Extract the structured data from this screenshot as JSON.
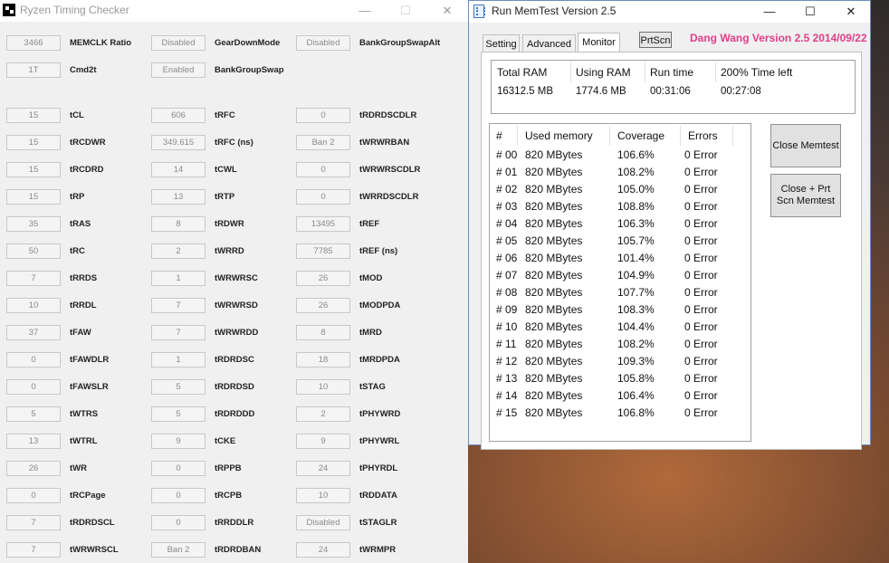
{
  "rtc": {
    "title": "Ryzen Timing Checker",
    "minimize": "—",
    "maximize": "☐",
    "close": "✕",
    "top_rows": [
      [
        {
          "v": "3466",
          "l": "MEMCLK Ratio"
        },
        {
          "v": "Disabled",
          "l": "GearDownMode"
        },
        {
          "v": "Disabled",
          "l": "BankGroupSwapAlt"
        }
      ],
      [
        {
          "v": "1T",
          "l": "Cmd2t"
        },
        {
          "v": "Enabled",
          "l": "BankGroupSwap"
        }
      ]
    ],
    "rows": [
      [
        {
          "v": "15",
          "l": "tCL"
        },
        {
          "v": "606",
          "l": "tRFC"
        },
        {
          "v": "0",
          "l": "tRDRDSCDLR"
        }
      ],
      [
        {
          "v": "15",
          "l": "tRCDWR"
        },
        {
          "v": "349.615",
          "l": "tRFC (ns)"
        },
        {
          "v": "Ban 2",
          "l": "tWRWRBAN"
        }
      ],
      [
        {
          "v": "15",
          "l": "tRCDRD"
        },
        {
          "v": "14",
          "l": "tCWL"
        },
        {
          "v": "0",
          "l": "tWRWRSCDLR"
        }
      ],
      [
        {
          "v": "15",
          "l": "tRP"
        },
        {
          "v": "13",
          "l": "tRTP"
        },
        {
          "v": "0",
          "l": "tWRRDSCDLR"
        }
      ],
      [
        {
          "v": "35",
          "l": "tRAS"
        },
        {
          "v": "8",
          "l": "tRDWR"
        },
        {
          "v": "13495",
          "l": "tREF"
        }
      ],
      [
        {
          "v": "50",
          "l": "tRC"
        },
        {
          "v": "2",
          "l": "tWRRD"
        },
        {
          "v": "7785",
          "l": "tREF (ns)"
        }
      ],
      [
        {
          "v": "7",
          "l": "tRRDS"
        },
        {
          "v": "1",
          "l": "tWRWRSC"
        },
        {
          "v": "26",
          "l": "tMOD"
        }
      ],
      [
        {
          "v": "10",
          "l": "tRRDL"
        },
        {
          "v": "7",
          "l": "tWRWRSD"
        },
        {
          "v": "26",
          "l": "tMODPDA"
        }
      ],
      [
        {
          "v": "37",
          "l": "tFAW"
        },
        {
          "v": "7",
          "l": "tWRWRDD"
        },
        {
          "v": "8",
          "l": "tMRD"
        }
      ],
      [
        {
          "v": "0",
          "l": "tFAWDLR"
        },
        {
          "v": "1",
          "l": "tRDRDSC"
        },
        {
          "v": "18",
          "l": "tMRDPDA"
        }
      ],
      [
        {
          "v": "0",
          "l": "tFAWSLR"
        },
        {
          "v": "5",
          "l": "tRDRDSD"
        },
        {
          "v": "10",
          "l": "tSTAG"
        }
      ],
      [
        {
          "v": "5",
          "l": "tWTRS"
        },
        {
          "v": "5",
          "l": "tRDRDDD"
        },
        {
          "v": "2",
          "l": "tPHYWRD"
        }
      ],
      [
        {
          "v": "13",
          "l": "tWTRL"
        },
        {
          "v": "9",
          "l": "tCKE"
        },
        {
          "v": "9",
          "l": "tPHYWRL"
        }
      ],
      [
        {
          "v": "26",
          "l": "tWR"
        },
        {
          "v": "0",
          "l": "tRPPB"
        },
        {
          "v": "24",
          "l": "tPHYRDL"
        }
      ],
      [
        {
          "v": "0",
          "l": "tRCPage"
        },
        {
          "v": "0",
          "l": "tRCPB"
        },
        {
          "v": "10",
          "l": "tRDDATA"
        }
      ],
      [
        {
          "v": "7",
          "l": "tRDRDSCL"
        },
        {
          "v": "0",
          "l": "tRRDDLR"
        },
        {
          "v": "Disabled",
          "l": "tSTAGLR"
        }
      ],
      [
        {
          "v": "7",
          "l": "tWRWRSCL"
        },
        {
          "v": "Ban 2",
          "l": "tRDRDBAN"
        },
        {
          "v": "24",
          "l": "tWRMPR"
        }
      ]
    ]
  },
  "memtest": {
    "title": "Run MemTest Version 2.5",
    "minimize": "—",
    "maximize": "☐",
    "close": "✕",
    "tabs": [
      "Setting",
      "Advanced",
      "Monitor"
    ],
    "prtscn": "PrtScn",
    "credit": "Dang Wang Version 2.5 2014/09/22",
    "stats": {
      "headers": [
        "Total RAM",
        "Using RAM",
        "Run time",
        "200% Time left"
      ],
      "values": [
        "16312.5 MB",
        "1774.6 MB",
        "00:31:06",
        "00:27:08"
      ]
    },
    "list_headers": [
      "#",
      "Used memory",
      "Coverage",
      "Errors"
    ],
    "rows": [
      [
        "# 00",
        "820 MBytes",
        "106.6%",
        "0 Error"
      ],
      [
        "# 01",
        "820 MBytes",
        "108.2%",
        "0 Error"
      ],
      [
        "# 02",
        "820 MBytes",
        "105.0%",
        "0 Error"
      ],
      [
        "# 03",
        "820 MBytes",
        "108.8%",
        "0 Error"
      ],
      [
        "# 04",
        "820 MBytes",
        "106.3%",
        "0 Error"
      ],
      [
        "# 05",
        "820 MBytes",
        "105.7%",
        "0 Error"
      ],
      [
        "# 06",
        "820 MBytes",
        "101.4%",
        "0 Error"
      ],
      [
        "# 07",
        "820 MBytes",
        "104.9%",
        "0 Error"
      ],
      [
        "# 08",
        "820 MBytes",
        "107.7%",
        "0 Error"
      ],
      [
        "# 09",
        "820 MBytes",
        "108.3%",
        "0 Error"
      ],
      [
        "# 10",
        "820 MBytes",
        "104.4%",
        "0 Error"
      ],
      [
        "# 11",
        "820 MBytes",
        "108.2%",
        "0 Error"
      ],
      [
        "# 12",
        "820 MBytes",
        "109.3%",
        "0 Error"
      ],
      [
        "# 13",
        "820 MBytes",
        "105.8%",
        "0 Error"
      ],
      [
        "# 14",
        "820 MBytes",
        "106.4%",
        "0 Error"
      ],
      [
        "# 15",
        "820 MBytes",
        "106.8%",
        "0 Error"
      ]
    ],
    "close_memtest": "Close Memtest",
    "close_prt_line1": "Close +     Prt",
    "close_prt_line2": "Scn Memtest"
  }
}
